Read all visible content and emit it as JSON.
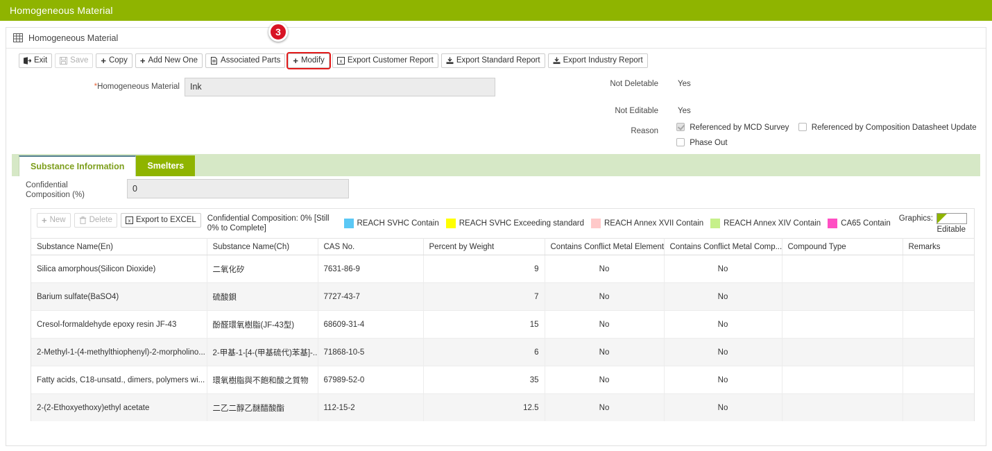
{
  "appbar": {
    "title": "Homogeneous Material"
  },
  "panel": {
    "title": "Homogeneous Material",
    "icon": "grid-icon"
  },
  "marker": {
    "label": "3"
  },
  "toolbar": {
    "buttons": [
      {
        "label": "Exit",
        "icon": "exit-icon",
        "disabled": false
      },
      {
        "label": "Save",
        "icon": "save-icon",
        "disabled": true
      },
      {
        "label": "Copy",
        "icon": "plus-icon",
        "disabled": false
      },
      {
        "label": "Add New One",
        "icon": "plus-icon",
        "disabled": false
      },
      {
        "label": "Associated Parts",
        "icon": "document-icon",
        "disabled": false
      },
      {
        "label": "Modify",
        "icon": "plus-icon",
        "disabled": false,
        "highlighted": true
      },
      {
        "label": "Export Customer Report",
        "icon": "excel-icon",
        "disabled": false
      },
      {
        "label": "Export Standard Report",
        "icon": "download-icon",
        "disabled": false
      },
      {
        "label": "Export Industry Report",
        "icon": "download-icon",
        "disabled": false
      }
    ]
  },
  "form": {
    "material_label": "Homogeneous Material",
    "material_required_mark": "*",
    "material_value": "Ink",
    "not_deletable_label": "Not Deletable",
    "not_deletable_value": "Yes",
    "not_editable_label": "Not Editable",
    "not_editable_value": "Yes",
    "reason_label": "Reason",
    "reason_options": [
      {
        "label": "Referenced by MCD Survey",
        "checked": true
      },
      {
        "label": "Referenced by Composition Datasheet Update",
        "checked": false
      },
      {
        "label": "Phase Out",
        "checked": false
      }
    ]
  },
  "tabs": [
    {
      "label": "Substance Information",
      "active": true
    },
    {
      "label": "Smelters",
      "active": false
    }
  ],
  "confidential": {
    "label_line1": "Confidential",
    "label_line2": "Composition (%)",
    "value": "0",
    "note": "Confidential Composition: 0% [Still 0% to Complete]"
  },
  "grid_toolbar": {
    "buttons": [
      {
        "label": "New",
        "icon": "plus-icon",
        "disabled": true
      },
      {
        "label": "Delete",
        "icon": "trash-icon",
        "disabled": true
      },
      {
        "label": "Export to EXCEL",
        "icon": "excel-icon",
        "disabled": false
      }
    ]
  },
  "legend": {
    "items": [
      {
        "label": "REACH SVHC Contain",
        "color": "#5BC8F5"
      },
      {
        "label": "REACH SVHC Exceeding standard",
        "color": "#FFFF00"
      },
      {
        "label": "REACH Annex XVII Contain",
        "color": "#FFC9C9"
      },
      {
        "label": "REACH Annex XIV Contain",
        "color": "#C6F08A"
      },
      {
        "label": "CA65 Contain",
        "color": "#FF4FC3"
      }
    ],
    "graphics_label": "Graphics:",
    "editable_label": "Editable",
    "editable_corner_color": "#8fb400"
  },
  "table": {
    "columns": [
      "Substance Name(En)",
      "Substance Name(Ch)",
      "CAS No.",
      "Percent by Weight",
      "Contains Conflict Metal Element",
      "Contains Conflict Metal Comp...",
      "Compound Type",
      "Remarks"
    ],
    "rows": [
      {
        "name_en": "Silica amorphous(Silicon Dioxide)",
        "name_ch": "二氧化矽",
        "cas": "7631-86-9",
        "percent": "9",
        "conflict_element": "No",
        "conflict_comp": "No",
        "compound_type": "",
        "remarks": ""
      },
      {
        "name_en": "Barium sulfate(BaSO4)",
        "name_ch": "硫酸鋇",
        "cas": "7727-43-7",
        "percent": "7",
        "conflict_element": "No",
        "conflict_comp": "No",
        "compound_type": "",
        "remarks": ""
      },
      {
        "name_en": "Cresol-formaldehyde epoxy resin JF-43",
        "name_ch": "酚醛環氧樹脂(JF-43型)",
        "cas": "68609-31-4",
        "percent": "15",
        "conflict_element": "No",
        "conflict_comp": "No",
        "compound_type": "",
        "remarks": ""
      },
      {
        "name_en": "2-Methyl-1-(4-methylthiophenyl)-2-morpholino...",
        "name_ch": "2-甲基-1-[4-(甲基硫代)苯基]-...",
        "cas": "71868-10-5",
        "percent": "6",
        "conflict_element": "No",
        "conflict_comp": "No",
        "compound_type": "",
        "remarks": ""
      },
      {
        "name_en": "Fatty acids, C18-unsatd., dimers, polymers wi...",
        "name_ch": "環氧樹脂與不飽和酸之質物",
        "cas": "67989-52-0",
        "percent": "35",
        "conflict_element": "No",
        "conflict_comp": "No",
        "compound_type": "",
        "remarks": ""
      },
      {
        "name_en": "2-(2-Ethoxyethoxy)ethyl acetate",
        "name_ch": "二乙二醇乙醚醋酸酯",
        "cas": "112-15-2",
        "percent": "12.5",
        "conflict_element": "No",
        "conflict_comp": "No",
        "compound_type": "",
        "remarks": ""
      }
    ]
  },
  "colors": {
    "brand_green": "#8fb400",
    "tab_strip": "#d6e8c6",
    "marker_red": "#d81324",
    "highlight_red": "#e21b1b"
  }
}
